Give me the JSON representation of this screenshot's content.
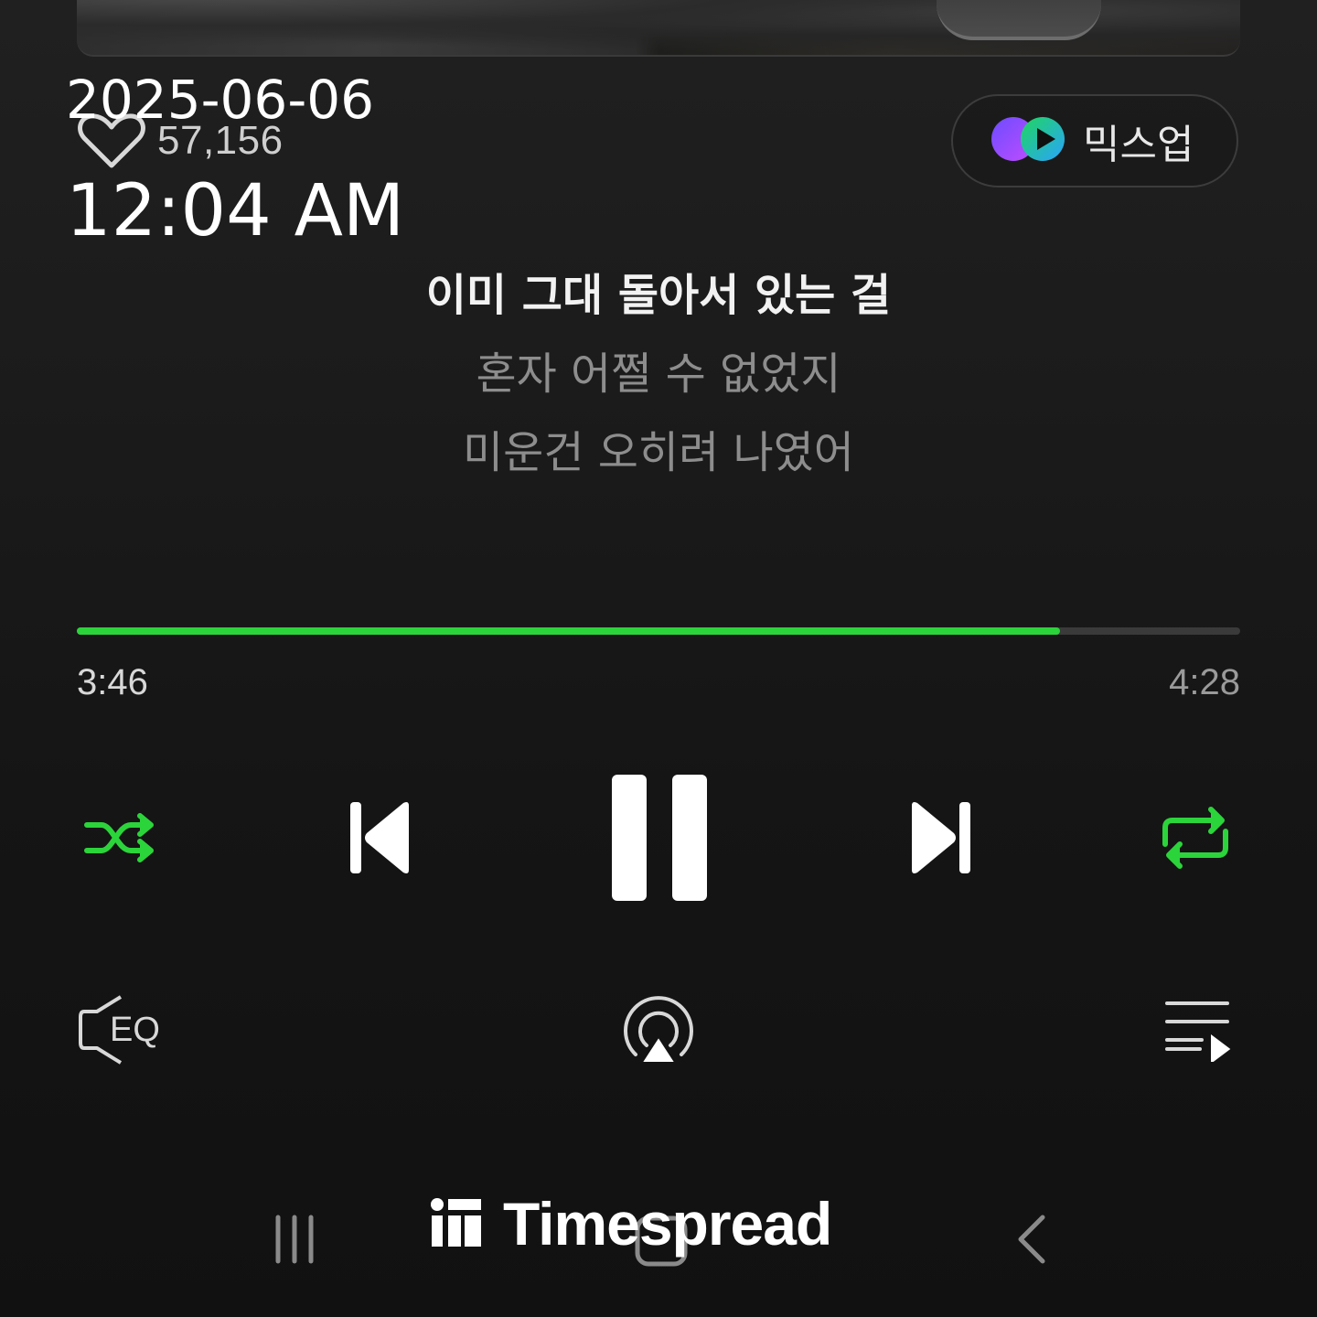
{
  "overlay": {
    "date": "2025-06-06",
    "time": "12:04 AM"
  },
  "track": {
    "like_count": "57,156",
    "like_icon": "heart-outline-icon"
  },
  "mixup": {
    "label": "믹스업",
    "icon": "mixup-logo-icon"
  },
  "lyrics": {
    "current": "이미 그대 돌아서 있는 걸",
    "next1": "혼자 어쩔 수 없었지",
    "next2": "미운건 오히려 나였어"
  },
  "playback": {
    "elapsed": "3:46",
    "total": "4:28",
    "progress_fraction": 0.845,
    "state": "playing"
  },
  "controls": {
    "shuffle_icon": "shuffle-icon",
    "previous_icon": "skip-previous-icon",
    "pause_icon": "pause-icon",
    "next_icon": "skip-next-icon",
    "repeat_icon": "repeat-icon",
    "shuffle_active": true,
    "repeat_active": true
  },
  "bottom_actions": {
    "eq_icon": "equalizer-speaker-icon",
    "eq_label": "EQ",
    "cast_icon": "airplay-icon",
    "playlist_icon": "playlist-icon"
  },
  "watermark": {
    "text": "Timespread"
  },
  "navbar": {
    "recents_icon": "recents-icon",
    "home_icon": "home-icon",
    "back_icon": "back-icon"
  },
  "colors": {
    "accent": "#2bd43a",
    "background": "#1a1a1a",
    "text_primary": "#f2f2f2",
    "text_secondary": "#8d8d8d"
  }
}
